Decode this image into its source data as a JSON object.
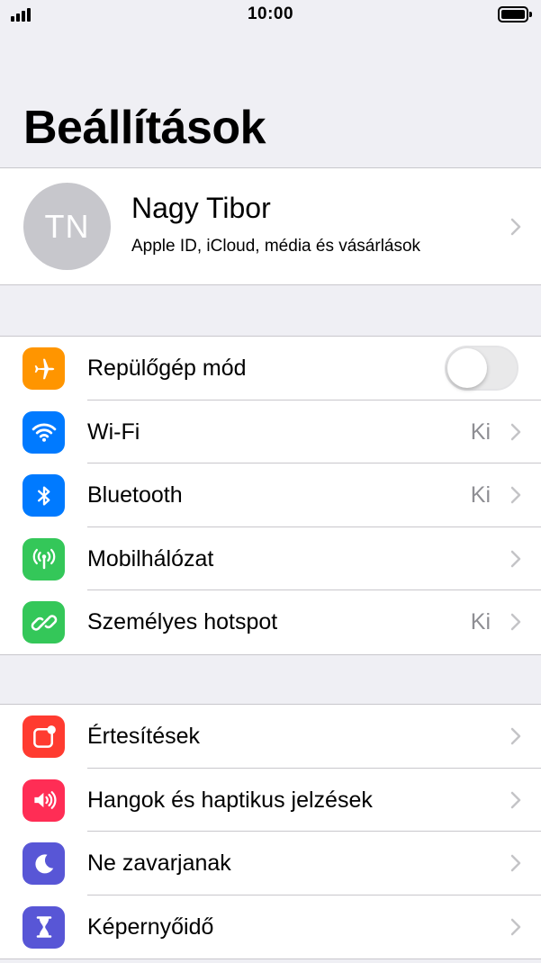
{
  "status_bar": {
    "time": "10:00"
  },
  "title": "Beállítások",
  "profile": {
    "initials": "TN",
    "name": "Nagy Tibor",
    "subtitle": "Apple ID, iCloud, média és vásárlások"
  },
  "group1": [
    {
      "label": "Repülőgép mód",
      "icon": "airplane-icon",
      "color": "#ff9500",
      "toggle": "off"
    },
    {
      "label": "Wi-Fi",
      "icon": "wifi-icon",
      "color": "#007aff",
      "value": "Ki"
    },
    {
      "label": "Bluetooth",
      "icon": "bluetooth-icon",
      "color": "#007aff",
      "value": "Ki"
    },
    {
      "label": "Mobilhálózat",
      "icon": "cellular-icon",
      "color": "#34c759",
      "value": ""
    },
    {
      "label": "Személyes hotspot",
      "icon": "hotspot-icon",
      "color": "#34c759",
      "value": "Ki"
    }
  ],
  "group2": [
    {
      "label": "Értesítések",
      "icon": "notifications-icon",
      "color": "#ff3b30"
    },
    {
      "label": "Hangok és haptikus jelzések",
      "icon": "sounds-icon",
      "color": "#ff2d55"
    },
    {
      "label": "Ne zavarjanak",
      "icon": "moon-icon",
      "color": "#5856d6"
    },
    {
      "label": "Képernyőidő",
      "icon": "hourglass-icon",
      "color": "#5856d6"
    }
  ]
}
